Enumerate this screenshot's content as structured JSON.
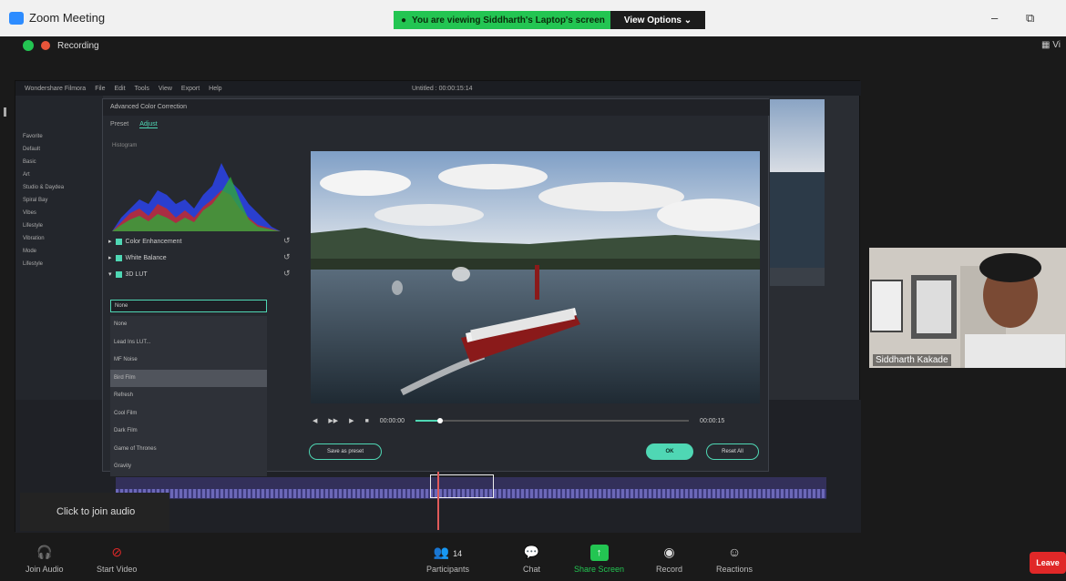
{
  "window": {
    "title": "Zoom Meeting",
    "minimize": "–",
    "restore": "⧉"
  },
  "banner": {
    "text": "You are viewing Siddharth's Laptop's screen",
    "view_options": "View Options ⌄"
  },
  "recording": "Recording",
  "filmora": {
    "app": "Wondershare Filmora",
    "menu": [
      "File",
      "Edit",
      "Tools",
      "View",
      "Export",
      "Help"
    ],
    "title": "Untitled : 00:00:15:14",
    "sidebar": [
      "Favorite",
      "Default",
      "Basic",
      "Art",
      "Studio & Daydea",
      "Spiral Bay",
      "Vibes",
      "Lifestyle",
      "Vibration",
      "Mode",
      "Lifestyle"
    ]
  },
  "dialog": {
    "title": "Advanced Color Correction",
    "tabs": [
      "Preset",
      "Adjust"
    ],
    "histogram_label": "Histogram",
    "options": [
      "Color Enhancement",
      "White Balance",
      "3D LUT"
    ],
    "lut_selected": "None",
    "lut_items": [
      "None",
      "Lead Ins LUT...",
      "MF Noise",
      "Bird Film",
      "Refresh",
      "Cool Film",
      "Dark Film",
      "Game of Thrones",
      "Gravity"
    ],
    "time_start": "00:00:00",
    "time_end": "00:00:15",
    "progress": 0.09,
    "save_preset": "Save as preset",
    "ok": "OK",
    "reset_all": "Reset All"
  },
  "participant": {
    "name": "Siddharth Kakade"
  },
  "audio_tip": "Click to join audio",
  "toolbar": {
    "join_audio": "Join Audio",
    "start_video": "Start Video",
    "participants": "Participants",
    "participant_count": "14",
    "chat": "Chat",
    "share_screen": "Share Screen",
    "record": "Record",
    "reactions": "Reactions",
    "leave": "Leave"
  },
  "colors": {
    "zoom_blue": "#2d8cff",
    "share_green": "#23c552",
    "filmora_teal": "#4fd7b4",
    "leave_red": "#e02828"
  }
}
